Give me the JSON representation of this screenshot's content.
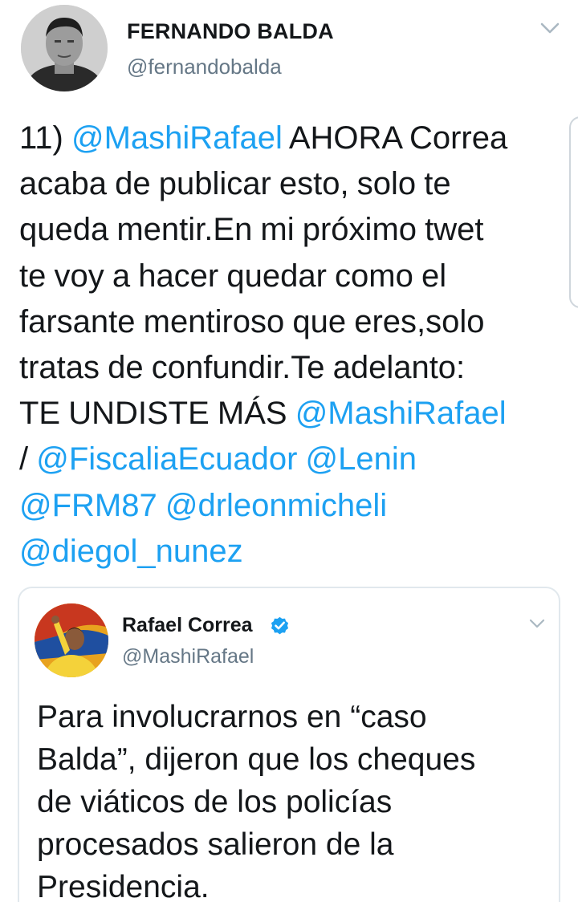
{
  "tweet": {
    "author": {
      "display_name": "FERNANDO BALDA",
      "handle": "@fernandobalda",
      "avatar_icon": "profile-photo"
    },
    "text_lines": [
      [
        {
          "t": "11) ",
          "m": false
        },
        {
          "t": "@MashiRafael",
          "m": true
        },
        {
          "t": " AHORA Correa",
          "m": false
        }
      ],
      [
        {
          "t": "acaba de publicar esto, solo te",
          "m": false
        }
      ],
      [
        {
          "t": "queda mentir.En mi próximo twet",
          "m": false
        }
      ],
      [
        {
          "t": "te voy a hacer quedar como el",
          "m": false
        }
      ],
      [
        {
          "t": "farsante mentiroso que eres,solo",
          "m": false
        }
      ],
      [
        {
          "t": "tratas de confundir.Te adelanto:",
          "m": false
        }
      ],
      [
        {
          "t": "TE UNDISTE MÁS  ",
          "m": false
        },
        {
          "t": "@MashiRafael",
          "m": true
        }
      ],
      [
        {
          "t": "/ ",
          "m": false
        },
        {
          "t": "@FiscaliaEcuador",
          "m": true
        },
        {
          "t": " ",
          "m": false
        },
        {
          "t": "@Lenin",
          "m": true
        }
      ],
      [
        {
          "t": "@FRM87",
          "m": true
        },
        {
          "t": " ",
          "m": false
        },
        {
          "t": "@drleonmicheli",
          "m": true
        }
      ],
      [
        {
          "t": "@diegol_nunez",
          "m": true
        }
      ]
    ]
  },
  "quoted_tweet": {
    "author": {
      "display_name": "Rafael Correa",
      "handle": "@MashiRafael",
      "verified": true,
      "avatar_icon": "profile-photo"
    },
    "text_lines": [
      "Para involucrarnos  en “caso",
      "Balda”, dijeron que los cheques",
      "de viáticos de los policías",
      "procesados salieron de la",
      "Presidencia."
    ]
  },
  "colors": {
    "text": "#14171a",
    "secondary": "#657786",
    "mention": "#1da1f2",
    "border": "#e1e8ed",
    "chevron": "#aab8c2"
  }
}
